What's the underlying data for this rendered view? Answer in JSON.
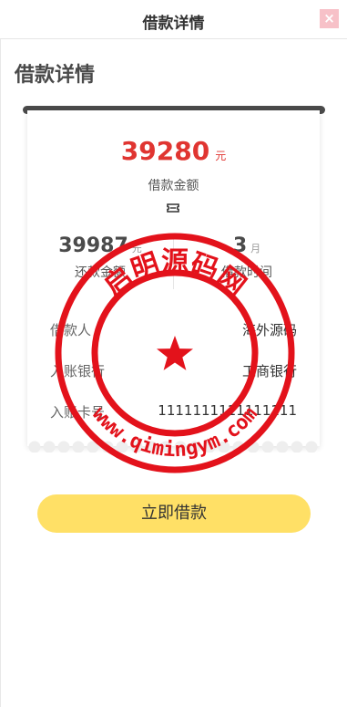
{
  "topbar": {
    "title": "借款详情",
    "close_glyph": "×"
  },
  "heading": "借款详情",
  "loan": {
    "amount": "39280",
    "amount_unit": "元",
    "amount_label": "借款金额",
    "repay_amount": "39987",
    "repay_unit": "元",
    "repay_label": "还款金额",
    "term": "3",
    "term_unit": "月",
    "term_label": "借款时间"
  },
  "details": [
    {
      "label": "借款人",
      "value": "海外源码"
    },
    {
      "label": "入账银行",
      "value": "工商银行"
    },
    {
      "label": "入账卡号",
      "value": "1111111111111111"
    }
  ],
  "stamp": {
    "top_text": "启明源码网",
    "bottom_text": "www.qimingym.com"
  },
  "cta": {
    "label": "立即借款"
  },
  "colors": {
    "accent": "#e03531",
    "button": "#ffe066",
    "stamp": "#e3121b",
    "close": "#f7c1c8"
  },
  "icons": {
    "close": "close-icon",
    "ticket": "ticket-icon",
    "star": "star-icon"
  }
}
